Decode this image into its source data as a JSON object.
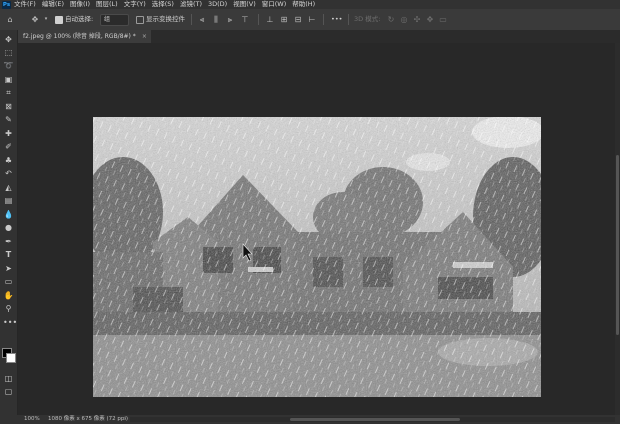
{
  "menu": {
    "logo": "Ps",
    "items": [
      "文件(F)",
      "编辑(E)",
      "图像(I)",
      "图层(L)",
      "文字(Y)",
      "选择(S)",
      "滤镜(T)",
      "3D(D)",
      "视图(V)",
      "窗口(W)",
      "帮助(H)"
    ],
    "minimize": "—",
    "maximize": "□",
    "close": "✕"
  },
  "options": {
    "auto_select_label": "自动选择:",
    "auto_select_value": "组",
    "show_transform_label": "显示变换控件",
    "mode_3d_label": "3D 模式:",
    "more": "•••"
  },
  "document": {
    "tab_title": "f2.jpeg @ 100% (除音 掉段, RGB/8#) *",
    "close": "×"
  },
  "status": {
    "zoom": "100%",
    "info": "1080 像素 x 675 像素 (72 ppi)",
    "arrow": "›"
  },
  "colors": {
    "foreground": "#000000",
    "background": "#ffffff"
  }
}
